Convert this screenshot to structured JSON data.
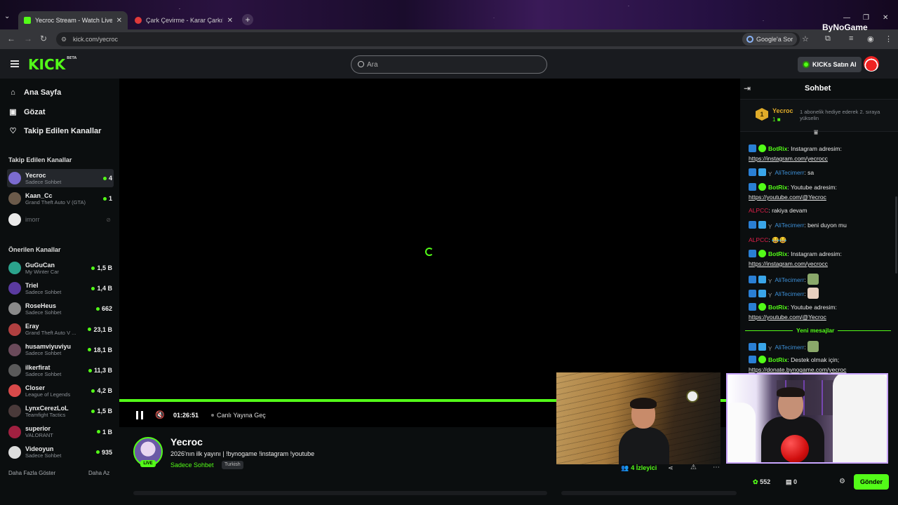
{
  "browser": {
    "tabs": [
      {
        "title": "Yecroc Stream - Watch Live on K",
        "fav_color": "#53fc18"
      },
      {
        "title": "Çark Çevirme - Karar Çarkı!",
        "fav_color": "#e03a3a"
      }
    ],
    "url": "kick.com/yecroc",
    "google_button": "Google'a Sor",
    "brand_overlay": "ByNoGame"
  },
  "header": {
    "logo": "KICK",
    "logo_badge": "BETA",
    "search_placeholder": "Ara",
    "kicks_button": "KICKs Satın Al"
  },
  "sidebar": {
    "nav": [
      {
        "label": "Ana Sayfa",
        "icon": "home-icon"
      },
      {
        "label": "Gözat",
        "icon": "browse-icon"
      },
      {
        "label": "Takip Edilen Kanallar",
        "icon": "heart-icon"
      }
    ],
    "followed_title": "Takip Edilen Kanallar",
    "followed": [
      {
        "name": "Yecroc",
        "sub": "Sadece Sohbet",
        "viewers": "4",
        "color": "#7b6bd0"
      },
      {
        "name": "Kaan_Cc",
        "sub": "Grand Theft Auto V (GTA)",
        "viewers": "1",
        "color": "#6b5a4a"
      },
      {
        "name": "imorr",
        "sub": "",
        "viewers": "",
        "color": "#eaeaea"
      }
    ],
    "recommended_title": "Önerilen Kanallar",
    "recommended": [
      {
        "name": "GuGuCan",
        "sub": "My Winter Car",
        "viewers": "1,5 B",
        "color": "#2ba38c"
      },
      {
        "name": "Triel",
        "sub": "Sadece Sohbet",
        "viewers": "1,4 B",
        "color": "#5a3aa0"
      },
      {
        "name": "RoseHeus",
        "sub": "Sadece Sohbet",
        "viewers": "662",
        "color": "#8a8a8a"
      },
      {
        "name": "Eray",
        "sub": "Grand Theft Auto V ...",
        "viewers": "23,1 B",
        "color": "#b04040"
      },
      {
        "name": "husamviyuviyu",
        "sub": "Sadece Sohbet",
        "viewers": "18,1 B",
        "color": "#6a4a5a"
      },
      {
        "name": "ilkerfirat",
        "sub": "Sadece Sohbet",
        "viewers": "11,3 B",
        "color": "#5a5a5a"
      },
      {
        "name": "Closer",
        "sub": "League of Legends",
        "viewers": "4,2 B",
        "color": "#d84a4a"
      },
      {
        "name": "LynxCerezLoL",
        "sub": "Teamfight Tactics",
        "viewers": "1,5 B",
        "color": "#4a3a3a"
      },
      {
        "name": "superior",
        "sub": "VALORANT",
        "viewers": "1 B",
        "color": "#a02040"
      },
      {
        "name": "Videoyun",
        "sub": "Sadece Sohbet",
        "viewers": "935",
        "color": "#dddddd"
      }
    ],
    "show_more": "Daha Fazla Göster",
    "show_less": "Daha Az"
  },
  "player": {
    "progress": 1.0,
    "timecode": "01:26:51",
    "go_live": "Canlı Yayına Geç"
  },
  "stream": {
    "name": "Yecroc",
    "live_badge": "LIVE",
    "title": "2026'nın ilk yayını | !bynogame !instagram !youtube",
    "category": "Sadece Sohbet",
    "tag": "Turkish",
    "viewers": "4 İzleyici"
  },
  "chat": {
    "title": "Sohbet",
    "gift": {
      "rank": "1",
      "name": "Yecroc",
      "count": "1",
      "note": "1 abonelik hediye ederek 2. sıraya yükselin"
    },
    "messages": [
      {
        "user": "BotRix",
        "text": ": Instagram adresim:",
        "link": "https://instagram.com/yecrocc"
      },
      {
        "user": "AliTecimerr",
        "text": ": sa"
      },
      {
        "user": "BotRix",
        "text": ": Youtube adresim:",
        "link": "https://youtube.com/@Yecroc"
      },
      {
        "user": "ALPCC",
        "text": ": rakiya devam"
      },
      {
        "user": "AliTecimerr",
        "text": ": beni duyon mu"
      },
      {
        "user": "ALPCC",
        "text": ": 😂😂"
      },
      {
        "user": "BotRix",
        "text": ": Instagram adresim:",
        "link": "https://instagram.com/yecrocc"
      },
      {
        "user": "AliTecimerr",
        "text": ":"
      },
      {
        "user": "AliTecimerr",
        "text": ":"
      },
      {
        "user": "BotRix",
        "text": ": Youtube adresim:",
        "link": "https://youtube.com/@Yecroc"
      },
      {
        "user": "AliTecimerr",
        "text": ":"
      },
      {
        "user": "BotRix",
        "text": ": Destek olmak için;",
        "link": "https://donate.bynogame.com/yecroc"
      }
    ],
    "new_messages": "Yeni mesajlar",
    "points": "552",
    "drops": "0",
    "send": "Gönder"
  }
}
